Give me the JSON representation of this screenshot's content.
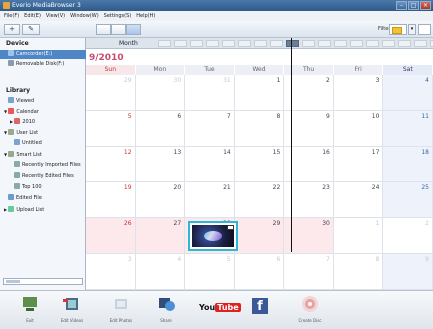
{
  "window": {
    "title": "Everio MediaBrowser 3"
  },
  "menu": [
    "File(F)",
    "Edit(E)",
    "View(V)",
    "Window(W)",
    "Settings(S)",
    "Help(H)"
  ],
  "toolbar": {
    "add_label": "+",
    "pen_label": "✎",
    "filter_label": "Filter"
  },
  "sidebar": {
    "device_header": "Device",
    "devices": [
      "Camcorder(E:)",
      "Removable Disk(F:)"
    ],
    "library_header": "Library",
    "library": [
      "Viewed",
      "Calendar",
      "2010",
      "User List",
      "Untitled",
      "Smart List",
      "Recently Imported Files",
      "Recently Edited Files",
      "Top 100",
      "Edited File",
      "Upload List"
    ]
  },
  "timeline": {
    "mode_label": "Month",
    "active_index": 8
  },
  "calendar": {
    "title": "9/2010",
    "weekdays": [
      "Sun",
      "Mon",
      "Tue",
      "Wed",
      "Thu",
      "Fri",
      "Sat"
    ],
    "weeks": [
      [
        "29",
        "30",
        "31",
        "1",
        "2",
        "3",
        "4"
      ],
      [
        "5",
        "6",
        "7",
        "8",
        "9",
        "10",
        "11"
      ],
      [
        "12",
        "13",
        "14",
        "15",
        "16",
        "17",
        "18"
      ],
      [
        "19",
        "20",
        "21",
        "22",
        "23",
        "24",
        "25"
      ],
      [
        "26",
        "27",
        "28",
        "29",
        "30",
        "1",
        "2"
      ],
      [
        "3",
        "4",
        "5",
        "6",
        "7",
        "8",
        "9"
      ]
    ]
  },
  "bottom_buttons": [
    {
      "label": "Exit",
      "icon": "import-icon"
    },
    {
      "label": "Edit Videos",
      "icon": "film-edit-icon"
    },
    {
      "label": "Edit Photos",
      "icon": "photo-edit-icon"
    },
    {
      "label": "Share",
      "icon": "share-icon"
    },
    {
      "label": "",
      "icon": "youtube-icon"
    },
    {
      "label": "",
      "icon": "facebook-icon"
    },
    {
      "label": "Create Disc",
      "icon": "disc-icon"
    }
  ],
  "youtube_text": [
    "You",
    "Tube"
  ],
  "facebook_text": "f",
  "colors": {
    "accent": "#2ab8d6",
    "selected": "#4f86c6",
    "sunday": "#cc3333"
  }
}
